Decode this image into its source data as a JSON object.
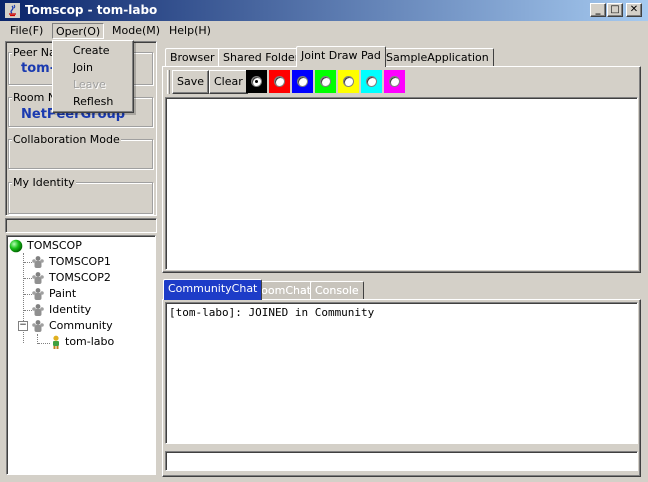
{
  "window": {
    "title": "Tomscop - tom-labo",
    "minimize_glyph": "_",
    "maximize_glyph": "□",
    "close_glyph": "✕"
  },
  "menu": {
    "items": [
      {
        "label": "File(F)"
      },
      {
        "label": "Oper(O)"
      },
      {
        "label": "Mode(M)"
      },
      {
        "label": "Help(H)"
      }
    ],
    "open_index": 1,
    "dropdown": [
      {
        "label": "Create",
        "enabled": true
      },
      {
        "label": "Join",
        "enabled": true
      },
      {
        "label": "Leave",
        "enabled": false
      },
      {
        "label": "Reflesh",
        "enabled": true
      }
    ]
  },
  "info_panel": {
    "peer_name_label": "Peer Na",
    "peer_name_value": "tom-",
    "room_name_label": "Room N",
    "room_name_value": "NetPeerGroup",
    "collaboration_mode_label": "Collaboration Mode",
    "my_identity_label": "My Identity"
  },
  "tree": {
    "root": "TOMSCOP",
    "children": [
      "TOMSCOP1",
      "TOMSCOP2",
      "Paint",
      "Identity",
      "Community"
    ],
    "community_members": [
      "tom-labo"
    ],
    "collapse_glyph": "−"
  },
  "top_tabs": {
    "items": [
      "Browser",
      "Shared Folder",
      "Joint Draw Pad",
      "SampleApplication"
    ],
    "selected_index": 2
  },
  "draw_toolbar": {
    "save_label": "Save",
    "clear_label": "Clear",
    "colors": [
      "#000000",
      "#ff0000",
      "#0000ff",
      "#00ff00",
      "#ffff00",
      "#00ffff",
      "#ff00ff"
    ],
    "selected_color_index": 0
  },
  "bottom_tabs": {
    "items": [
      "CommunityChat",
      "RoomChat",
      "Console"
    ],
    "selected_index": 0
  },
  "chat": {
    "lines": [
      "[tom-labo]: JOINED in Community"
    ],
    "input_value": ""
  }
}
